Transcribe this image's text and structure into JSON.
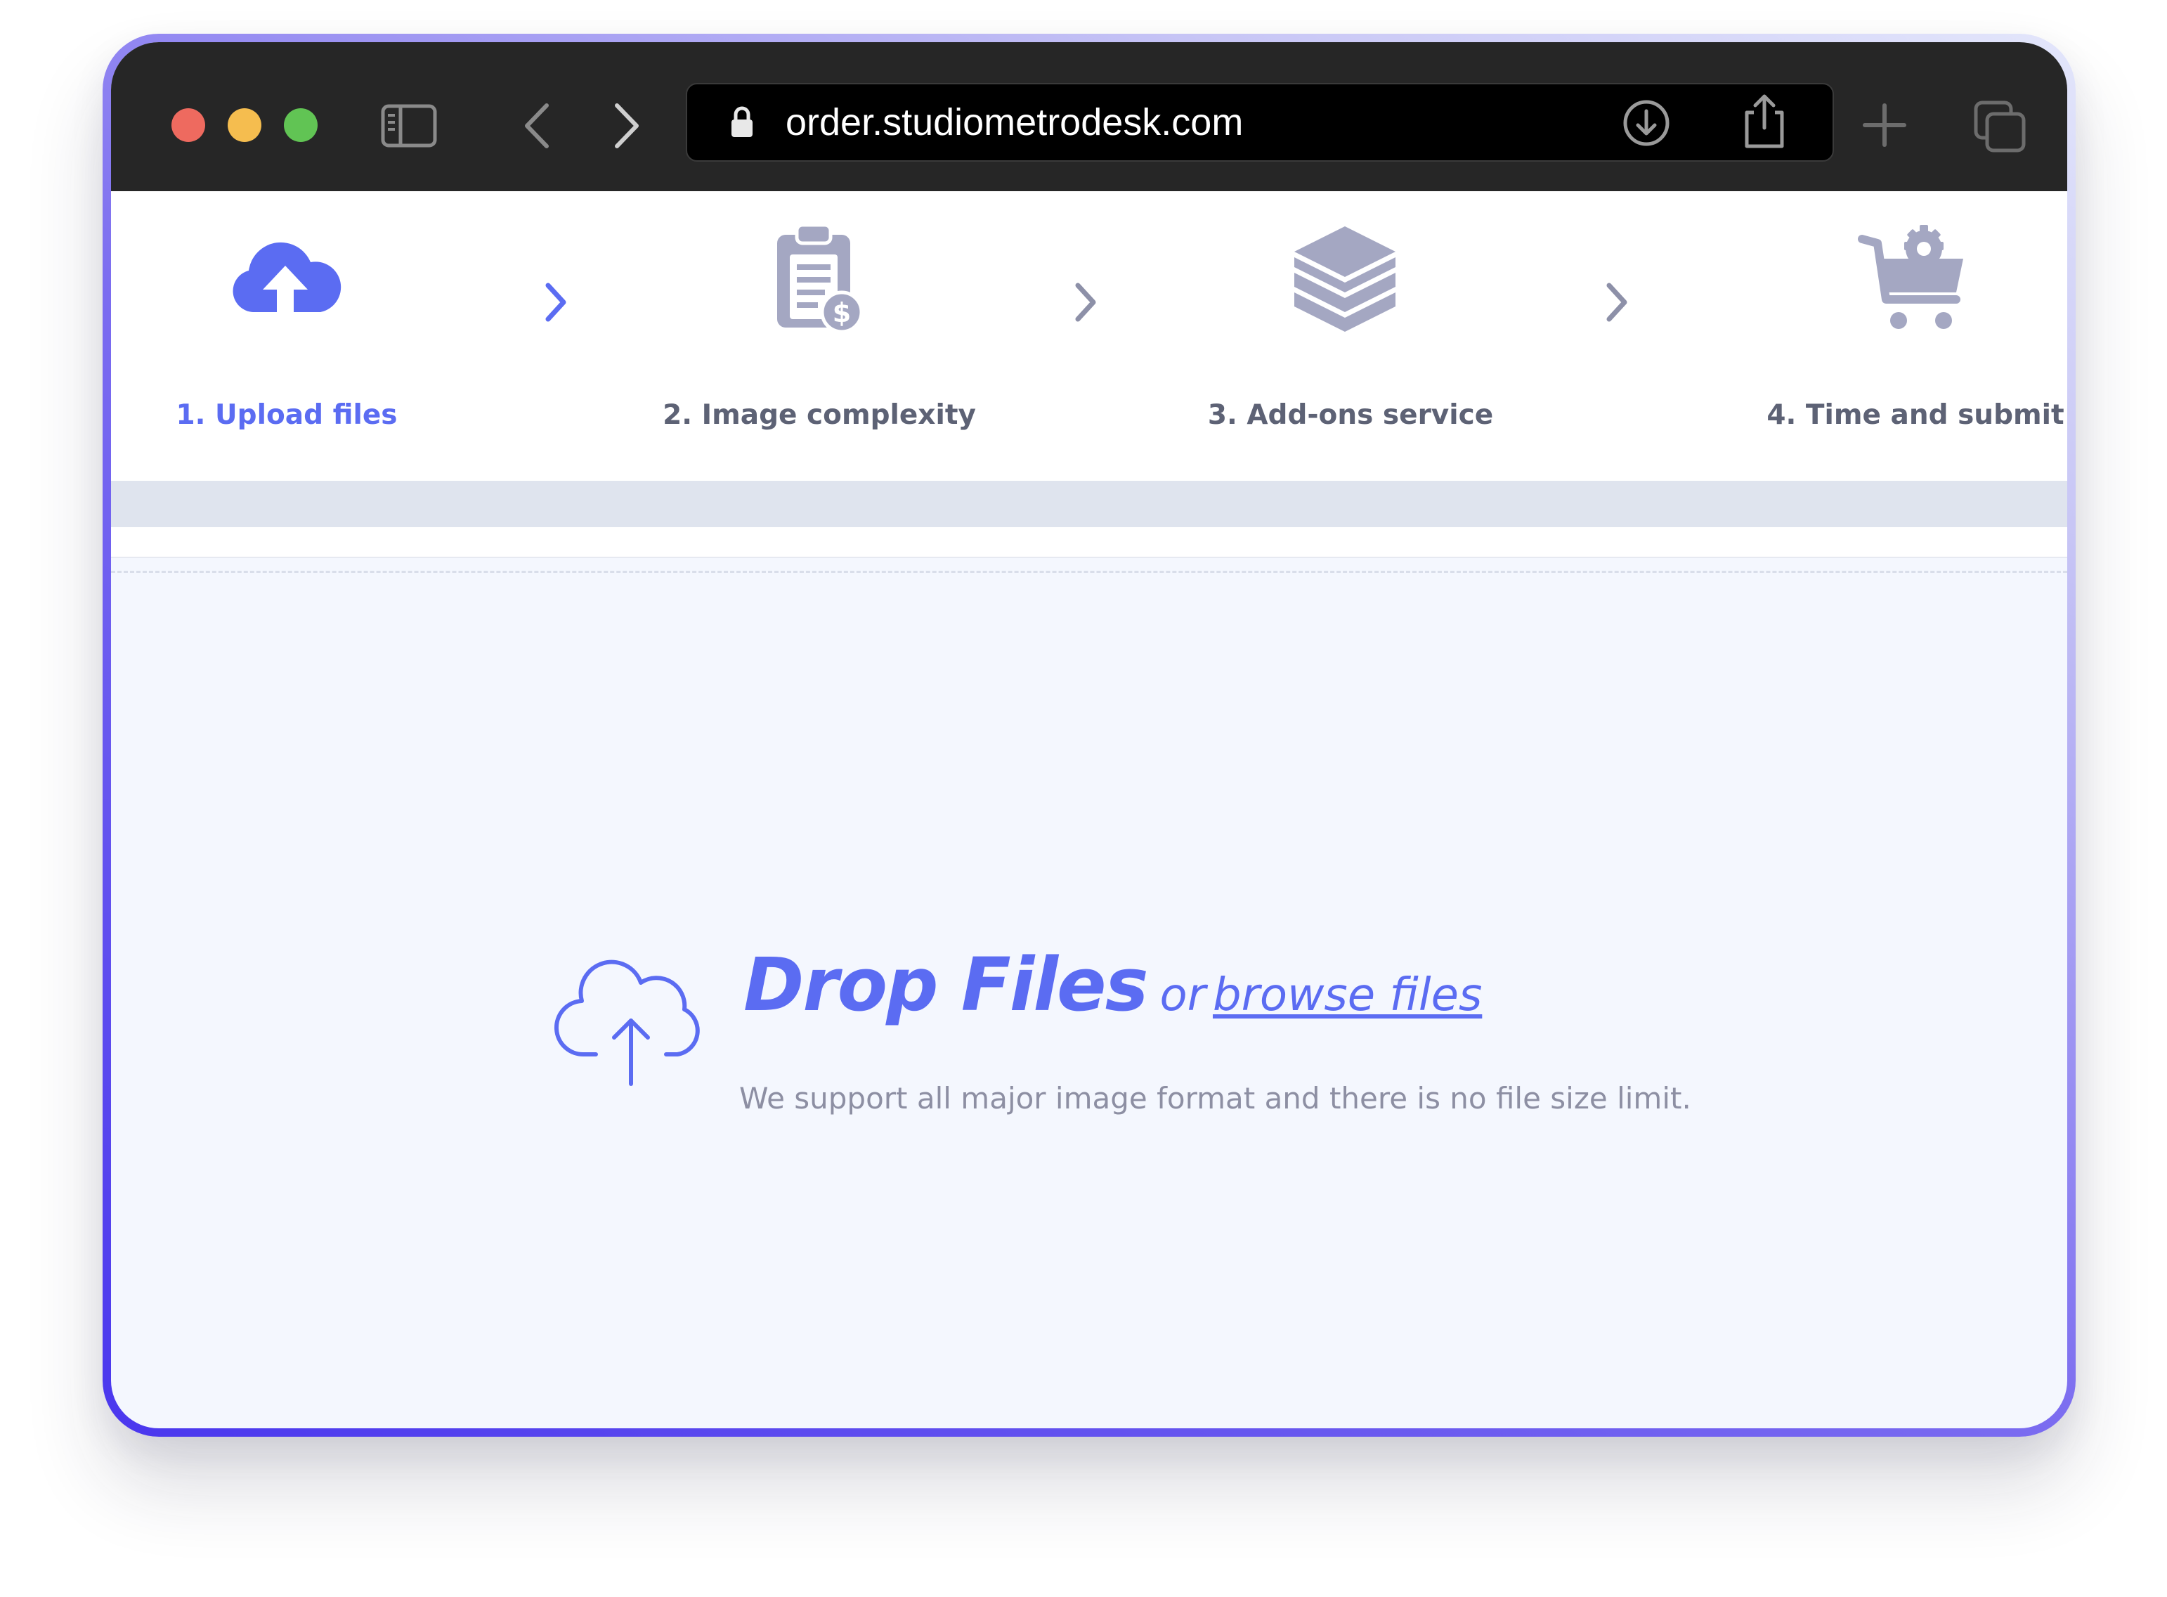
{
  "browser": {
    "url": "order.studiometrodesk.com",
    "icons": [
      "sidebar-icon",
      "back-icon",
      "forward-icon",
      "lock-icon",
      "download-icon",
      "share-icon",
      "new-tab-icon",
      "tabs-overview-icon"
    ]
  },
  "steps": [
    {
      "label": "1. Upload files",
      "icon": "cloud-upload-icon",
      "active": true
    },
    {
      "label": "2. Image complexity",
      "icon": "clipboard-price-icon",
      "active": false
    },
    {
      "label": "3. Add-ons service",
      "icon": "layers-icon",
      "active": false
    },
    {
      "label": "4. Time and submit",
      "icon": "cart-gear-icon",
      "active": false
    }
  ],
  "dropzone": {
    "title": "Drop Files",
    "or": "or",
    "browse": "browse files",
    "subtitle": "We support all major image format and there is no file size limit."
  },
  "colors": {
    "accent": "#5b6cf2",
    "inactive_icon": "#a4a7c2",
    "toolbar": "#262626",
    "dropzone_bg": "#f4f7fe"
  }
}
